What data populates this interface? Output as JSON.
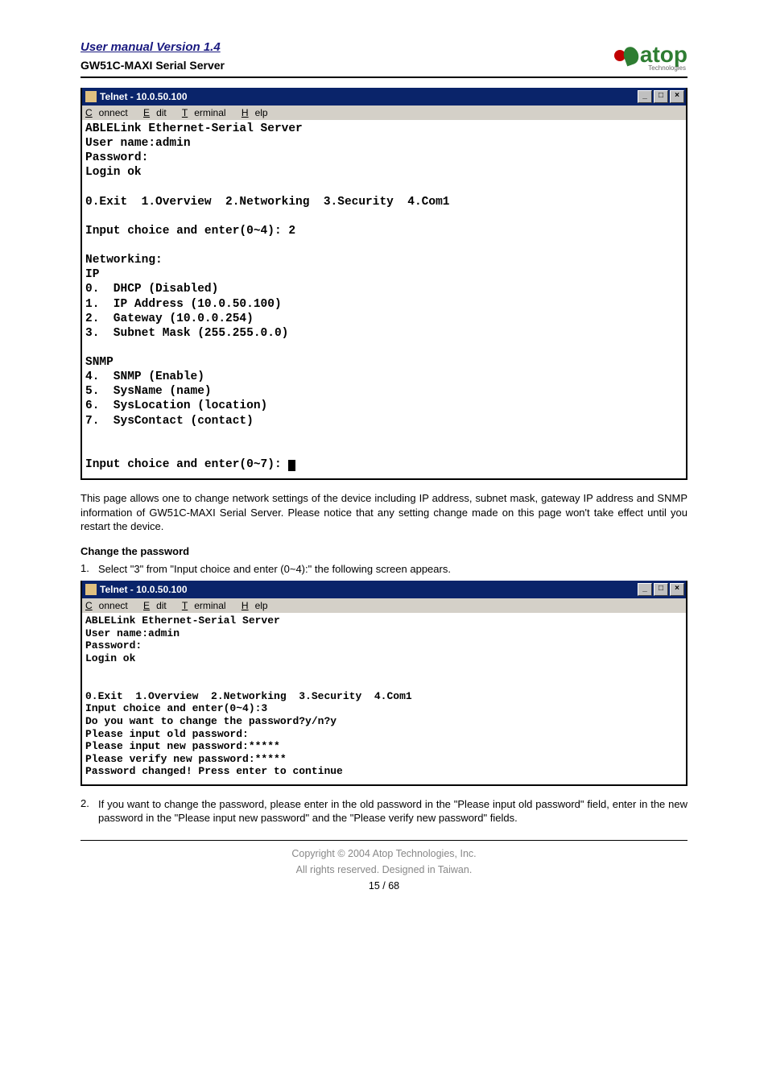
{
  "header": {
    "manual_link": "User manual Version 1.4",
    "product": "GW51C-MAXI Serial Server",
    "logo_text": "atop",
    "logo_sub": "Technologies"
  },
  "telnet1": {
    "title": "Telnet - 10.0.50.100",
    "menu": {
      "connect": "Connect",
      "edit": "Edit",
      "terminal": "Terminal",
      "help": "Help"
    },
    "lines": [
      "ABLELink Ethernet-Serial Server",
      "User name:admin",
      "Password:",
      "Login ok",
      "",
      "0.Exit  1.Overview  2.Networking  3.Security  4.Com1",
      "",
      "Input choice and enter(0~4): 2",
      "",
      "Networking:",
      "IP",
      "0.  DHCP (Disabled)",
      "1.  IP Address (10.0.50.100)",
      "2.  Gateway (10.0.0.254)",
      "3.  Subnet Mask (255.255.0.0)",
      "",
      "SNMP",
      "4.  SNMP (Enable)",
      "5.  SysName (name)",
      "6.  SysLocation (location)",
      "7.  SysContact (contact)",
      "",
      "",
      "Input choice and enter(0~7): "
    ]
  },
  "paragraph1": "This page allows one to change network settings of the device including IP address, subnet mask, gateway IP address and SNMP information of GW51C-MAXI Serial Server. Please notice that any setting change made on this page won't take effect until you restart the device.",
  "section_head": "Change the password",
  "step1_num": "1.",
  "step1": "Select \"3\" from \"Input choice and enter (0~4):\" the following screen appears.",
  "telnet2": {
    "title": "Telnet - 10.0.50.100",
    "menu": {
      "connect": "Connect",
      "edit": "Edit",
      "terminal": "Terminal",
      "help": "Help"
    },
    "lines": [
      "ABLELink Ethernet-Serial Server",
      "User name:admin",
      "Password:",
      "Login ok",
      "",
      "",
      "0.Exit  1.Overview  2.Networking  3.Security  4.Com1",
      "Input choice and enter(0~4):3",
      "Do you want to change the password?y/n?y",
      "Please input old password:",
      "Please input new password:*****",
      "Please verify new password:*****",
      "Password changed! Press enter to continue"
    ]
  },
  "step2_num": "2.",
  "step2": "If you want to change the password, please enter in the old password in the \"Please input old password\" field, enter in the new password in the \"Please input new password\" and the \"Please verify new password\" fields.",
  "footer": {
    "copyright": "Copyright © 2004 Atop Technologies, Inc.",
    "rights": "All rights reserved. Designed in Taiwan.",
    "page": "15 / 68"
  },
  "win_controls": {
    "min": "_",
    "max": "□",
    "close": "×"
  }
}
